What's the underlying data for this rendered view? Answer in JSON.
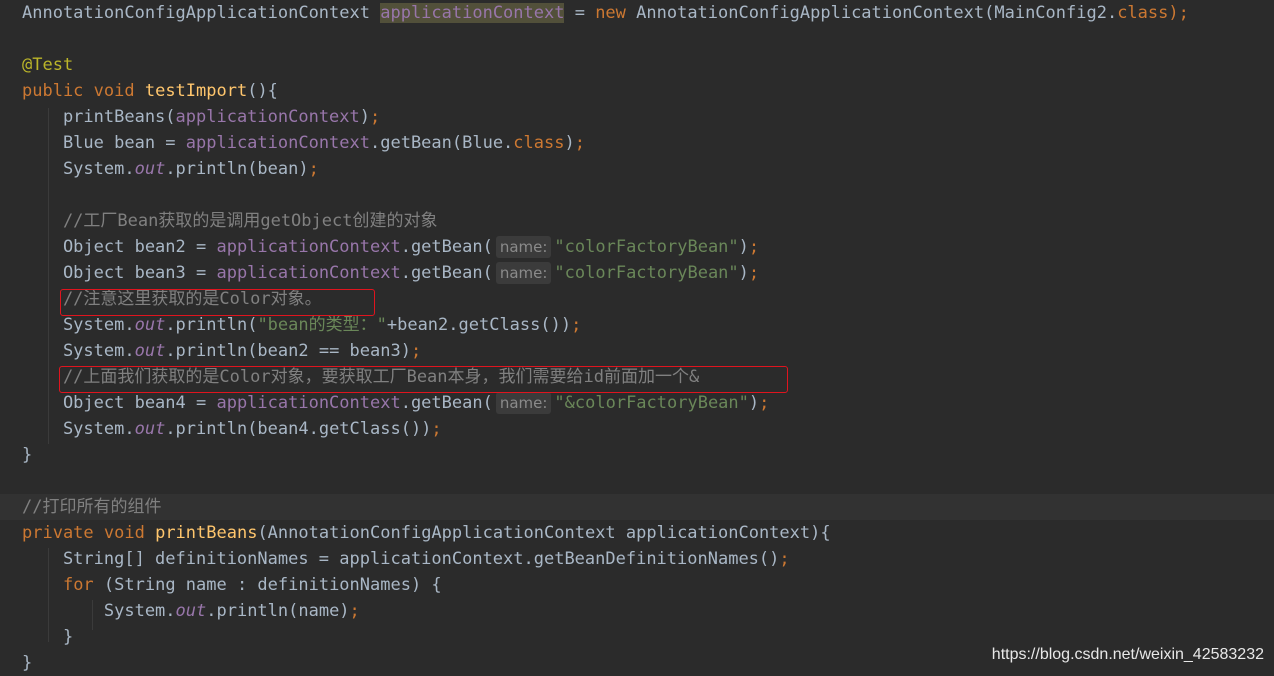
{
  "colors": {
    "background": "#2b2b2b",
    "default_text": "#a9b7c6",
    "keyword": "#cc7832",
    "field_purple": "#9876aa",
    "method_yellow": "#ffc66d",
    "string_green": "#6a8759",
    "comment_gray": "#808080",
    "annotation_yellow": "#bbb529",
    "hint_gray": "#8a8a8a",
    "box_red": "#e0141e"
  },
  "code_lines": [
    {
      "segments": [
        {
          "t": "AnnotationConfigApplicationContext ",
          "c": "default"
        },
        {
          "t": "applicationContext",
          "c": "field",
          "hl": true
        },
        {
          "t": " = ",
          "c": "default"
        },
        {
          "t": "new ",
          "c": "keyword"
        },
        {
          "t": "AnnotationConfigApplicationContext(MainConfig2.",
          "c": "default"
        },
        {
          "t": "class",
          "c": "keyword"
        },
        {
          "t": ");",
          "c": "keyword"
        }
      ]
    },
    {
      "segments": []
    },
    {
      "segments": [
        {
          "t": "@Test",
          "c": "annotation"
        }
      ]
    },
    {
      "segments": [
        {
          "t": "public ",
          "c": "keyword"
        },
        {
          "t": "void ",
          "c": "keyword"
        },
        {
          "t": "testImport",
          "c": "method"
        },
        {
          "t": "(){",
          "c": "default"
        }
      ]
    },
    {
      "segments": [
        {
          "t": "    printBeans(",
          "c": "default"
        },
        {
          "t": "applicationContext",
          "c": "field"
        },
        {
          "t": ")",
          "c": "default"
        },
        {
          "t": ";",
          "c": "keyword"
        }
      ]
    },
    {
      "segments": [
        {
          "t": "    Blue bean = ",
          "c": "default"
        },
        {
          "t": "applicationContext",
          "c": "field"
        },
        {
          "t": ".getBean(Blue.",
          "c": "default"
        },
        {
          "t": "class",
          "c": "keyword"
        },
        {
          "t": ")",
          "c": "default"
        },
        {
          "t": ";",
          "c": "keyword"
        }
      ]
    },
    {
      "segments": [
        {
          "t": "    System.",
          "c": "default"
        },
        {
          "t": "out",
          "c": "static"
        },
        {
          "t": ".println(bean)",
          "c": "default"
        },
        {
          "t": ";",
          "c": "keyword"
        }
      ]
    },
    {
      "segments": []
    },
    {
      "segments": [
        {
          "t": "    //工厂Bean获取的是调用getObject创建的对象",
          "c": "comment"
        }
      ]
    },
    {
      "segments": [
        {
          "t": "    Object bean2 = ",
          "c": "default"
        },
        {
          "t": "applicationContext",
          "c": "field"
        },
        {
          "t": ".getBean(",
          "c": "default"
        },
        {
          "hint": "name:"
        },
        {
          "t": "\"colorFactoryBean\"",
          "c": "string"
        },
        {
          "t": ")",
          "c": "default"
        },
        {
          "t": ";",
          "c": "keyword"
        }
      ]
    },
    {
      "segments": [
        {
          "t": "    Object bean3 = ",
          "c": "default"
        },
        {
          "t": "applicationContext",
          "c": "field"
        },
        {
          "t": ".getBean(",
          "c": "default"
        },
        {
          "hint": "name:"
        },
        {
          "t": "\"colorFactoryBean\"",
          "c": "string"
        },
        {
          "t": ")",
          "c": "default"
        },
        {
          "t": ";",
          "c": "keyword"
        }
      ]
    },
    {
      "segments": [
        {
          "t": "    //注意这里获取的是Color对象。",
          "c": "comment"
        }
      ]
    },
    {
      "segments": [
        {
          "t": "    System.",
          "c": "default"
        },
        {
          "t": "out",
          "c": "static"
        },
        {
          "t": ".println(",
          "c": "default"
        },
        {
          "t": "\"bean的类型：\"",
          "c": "string"
        },
        {
          "t": "+bean2.getClass())",
          "c": "default"
        },
        {
          "t": ";",
          "c": "keyword"
        }
      ]
    },
    {
      "segments": [
        {
          "t": "    System.",
          "c": "default"
        },
        {
          "t": "out",
          "c": "static"
        },
        {
          "t": ".println(bean2 == bean3)",
          "c": "default"
        },
        {
          "t": ";",
          "c": "keyword"
        }
      ]
    },
    {
      "segments": [
        {
          "t": "    //上面我们获取的是Color对象，要获取工厂Bean本身，我们需要给id前面加一个&",
          "c": "comment"
        }
      ]
    },
    {
      "segments": [
        {
          "t": "    Object bean4 = ",
          "c": "default"
        },
        {
          "t": "applicationContext",
          "c": "field"
        },
        {
          "t": ".getBean(",
          "c": "default"
        },
        {
          "hint": "name:"
        },
        {
          "t": "\"&colorFactoryBean\"",
          "c": "string"
        },
        {
          "t": ")",
          "c": "default"
        },
        {
          "t": ";",
          "c": "keyword"
        }
      ]
    },
    {
      "segments": [
        {
          "t": "    System.",
          "c": "default"
        },
        {
          "t": "out",
          "c": "static"
        },
        {
          "t": ".println(bean4.getClass())",
          "c": "default"
        },
        {
          "t": ";",
          "c": "keyword"
        }
      ]
    },
    {
      "segments": [
        {
          "t": "}",
          "c": "default"
        }
      ]
    },
    {
      "segments": []
    },
    {
      "segments": [
        {
          "t": "//打印所有的组件",
          "c": "comment"
        }
      ],
      "band": true
    },
    {
      "segments": [
        {
          "t": "private ",
          "c": "keyword"
        },
        {
          "t": "void ",
          "c": "keyword"
        },
        {
          "t": "printBeans",
          "c": "method"
        },
        {
          "t": "(AnnotationConfigApplicationContext applicationContext){",
          "c": "default"
        }
      ]
    },
    {
      "segments": [
        {
          "t": "    String[] definitionNames = applicationContext.getBeanDefinitionNames()",
          "c": "default"
        },
        {
          "t": ";",
          "c": "keyword"
        }
      ]
    },
    {
      "segments": [
        {
          "t": "    ",
          "c": "default"
        },
        {
          "t": "for ",
          "c": "keyword"
        },
        {
          "t": "(String name : definitionNames) {",
          "c": "default"
        }
      ]
    },
    {
      "segments": [
        {
          "t": "        System.",
          "c": "default"
        },
        {
          "t": "out",
          "c": "static"
        },
        {
          "t": ".println(name)",
          "c": "default"
        },
        {
          "t": ";",
          "c": "keyword"
        }
      ]
    },
    {
      "segments": [
        {
          "t": "    }",
          "c": "default"
        }
      ]
    },
    {
      "segments": [
        {
          "t": "}",
          "c": "default"
        }
      ]
    }
  ],
  "watermark": "https://blog.csdn.net/weixin_42583232"
}
